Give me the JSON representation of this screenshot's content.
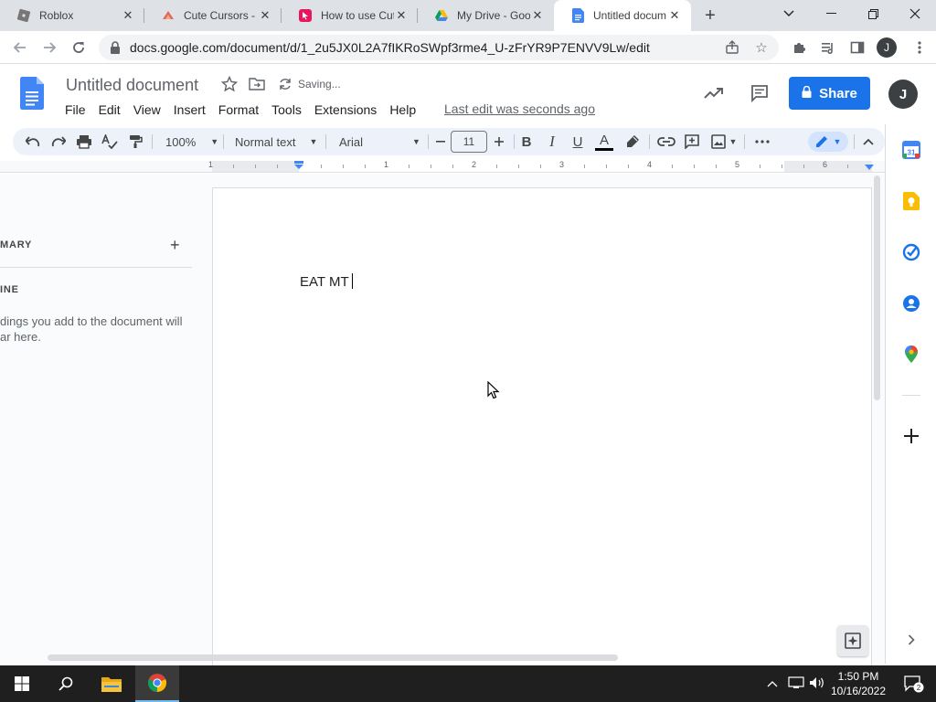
{
  "browser": {
    "tabs": [
      {
        "title": "Roblox",
        "active": false
      },
      {
        "title": "Cute Cursors - C",
        "active": false
      },
      {
        "title": "How to use Cut",
        "active": false
      },
      {
        "title": "My Drive - Goo",
        "active": false
      },
      {
        "title": "Untitled docum",
        "active": true
      }
    ],
    "url": "docs.google.com/document/d/1_2u5JX0L2A7fIKRoSWpf3rme4_U-zFrYR9P7ENVV9Lw/edit",
    "profile_initial": "J"
  },
  "docs": {
    "title": "Untitled document",
    "status": "Saving...",
    "menu": [
      "File",
      "Edit",
      "View",
      "Insert",
      "Format",
      "Tools",
      "Extensions",
      "Help"
    ],
    "last_edit": "Last edit was seconds ago",
    "share_label": "Share",
    "account_initial": "J"
  },
  "toolbar": {
    "zoom": "100%",
    "style": "Normal text",
    "font": "Arial",
    "font_size": "11"
  },
  "ruler": {
    "labels": [
      "1",
      "1",
      "2",
      "3",
      "4",
      "5",
      "6"
    ]
  },
  "outline": {
    "summary_heading": "MARY",
    "outline_heading": "INE",
    "empty_text": "dings you add to the document will ar here."
  },
  "document": {
    "body_text": "EAT MT"
  },
  "taskbar": {
    "time": "1:50 PM",
    "date": "10/16/2022",
    "notifications": "2"
  },
  "colors": {
    "accent": "#1a73e8",
    "toolbar_bg": "#edf2fa",
    "tab_strip": "#dee1e6"
  }
}
